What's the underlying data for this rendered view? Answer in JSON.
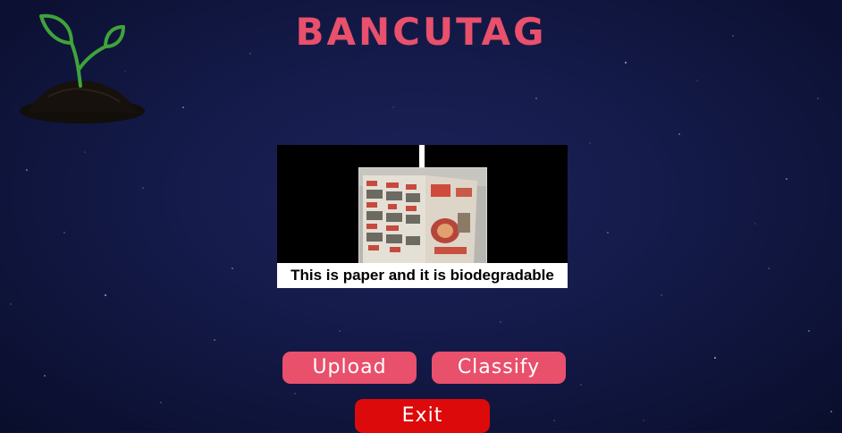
{
  "app": {
    "title": "BANCUTAG"
  },
  "icons": {
    "logo": "sprout-icon"
  },
  "result": {
    "caption": "This is paper and it is biodegradable"
  },
  "buttons": {
    "upload_label": "Upload",
    "classify_label": "Classify",
    "exit_label": "Exit"
  },
  "colors": {
    "accent": "#e8506c",
    "exit": "#dc0a0a",
    "background": "#141a48"
  }
}
